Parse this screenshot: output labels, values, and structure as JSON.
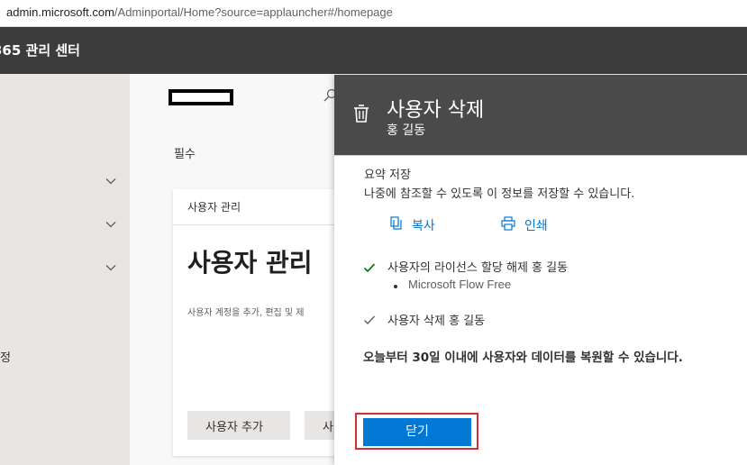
{
  "browser": {
    "url_host": "admin.microsoft.com",
    "url_path": "/Adminportal/Home?source=applauncher#/homepage"
  },
  "app": {
    "title": "365 관리 센터"
  },
  "nav": {
    "partial_item_label": "정"
  },
  "main": {
    "required_label": "필수",
    "card": {
      "header": "사용자 관리",
      "title": "사용자 관리",
      "description": "사용자 계정을 추가, 편집 및 제",
      "add_user_button": "사용자 추가",
      "second_button": "사"
    }
  },
  "panel": {
    "title": "사용자 삭제",
    "subtitle": "홍 길동",
    "summary_title": "요약 저장",
    "summary_desc": "나중에 참조할 수 있도록 이 정보를 저장할 수 있습니다.",
    "copy_label": "복사",
    "print_label": "인쇄",
    "results": [
      {
        "text": "사용자의 라이선스 할당 해제 홍 길동"
      },
      {
        "text": "사용자 삭제 홍 길동"
      }
    ],
    "license_item": "Microsoft Flow Free",
    "restore_note": "오늘부터 30일 이내에 사용자와 데이터를 복원할 수 있습니다.",
    "close_label": "닫기"
  },
  "colors": {
    "accent": "#0078d4",
    "header_bg": "#3c3c3c",
    "panel_header_bg": "#4a4a4a",
    "success": "#107c10",
    "highlight": "#d32f2f"
  }
}
